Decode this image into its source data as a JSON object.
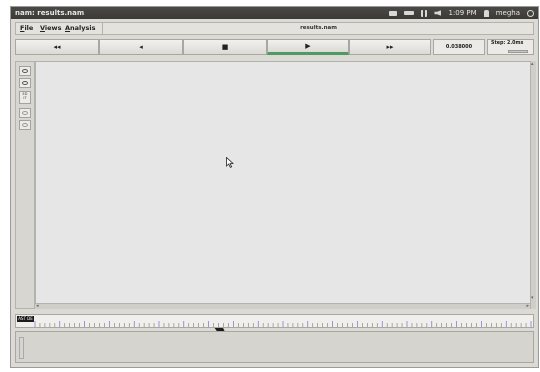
{
  "topbar": {
    "app_title": "nam: results.nam",
    "clock": "1:09 PM",
    "user": "megha",
    "icons": [
      "mail-icon",
      "battery-icon",
      "network-icon",
      "volume-icon",
      "user-icon",
      "power-icon"
    ]
  },
  "menubar": {
    "items": [
      "File",
      "Views",
      "Analysis"
    ],
    "mnemonics": [
      "F",
      "V",
      "A"
    ],
    "rest": [
      "ile",
      "iews",
      "nalysis"
    ],
    "file_title": "results.nam"
  },
  "controls": {
    "buttons": [
      {
        "name": "fast-rewind",
        "glyph": "◂◂"
      },
      {
        "name": "rewind",
        "glyph": "◂"
      },
      {
        "name": "stop",
        "glyph": "■"
      },
      {
        "name": "play",
        "glyph": "▶"
      },
      {
        "name": "fast-forward",
        "glyph": "▸▸"
      }
    ],
    "time": "0.038000",
    "step": "Step: 2.0ms"
  },
  "lefttools": {
    "items": [
      "zoom-in-icon",
      "zoom-out-icon",
      "edit-icon",
      "tool-4-icon",
      "tool-5-icon"
    ],
    "edit_label": "ED\nIT"
  },
  "timeline": {
    "handle_label": "AST DE",
    "tick_count": 100
  },
  "colors": {
    "canvas": "#e6e6e6",
    "play_accent": "#4e9a64",
    "node": "#1c1c1c"
  }
}
